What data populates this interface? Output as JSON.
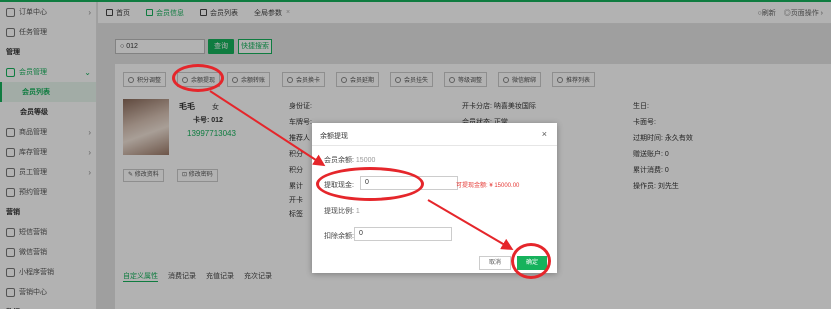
{
  "sidebar": {
    "items": [
      {
        "label": "订单中心",
        "type": "group"
      },
      {
        "label": "任务管理",
        "type": "plain"
      },
      {
        "label": "管理",
        "type": "section"
      },
      {
        "label": "会员管理",
        "type": "open"
      },
      {
        "label": "会员列表",
        "type": "active"
      },
      {
        "label": "会员等级",
        "type": "sub"
      },
      {
        "label": "商品管理",
        "type": "group"
      },
      {
        "label": "库存管理",
        "type": "group"
      },
      {
        "label": "员工管理",
        "type": "group"
      },
      {
        "label": "预约管理",
        "type": "plain"
      },
      {
        "label": "营销",
        "type": "section"
      },
      {
        "label": "短信营销",
        "type": "plain"
      },
      {
        "label": "微信营销",
        "type": "plain"
      },
      {
        "label": "小程序营销",
        "type": "plain"
      },
      {
        "label": "营销中心",
        "type": "plain"
      },
      {
        "label": "数据",
        "type": "section"
      }
    ]
  },
  "tabs": {
    "home": "首页",
    "member_info": "会员信息",
    "member_list": "会员列表",
    "global_params": "全局参数",
    "refresh": "刷新",
    "page_ops": "页面操作"
  },
  "search": {
    "value": "012",
    "query_label": "查询",
    "quick_label": "快捷搜索"
  },
  "toolbar": {
    "points": "积分调整",
    "withdraw": "余额提现",
    "transfer": "余额转账",
    "change_card": "会员换卡",
    "extend": "会员延期",
    "freeze": "会员挂失",
    "level": "等级调整",
    "wechat_unbind": "微信解绑",
    "referral": "推荐列表"
  },
  "member": {
    "name": "毛毛",
    "gender": "女",
    "card_no": "卡号: 012",
    "phone": "13997713043",
    "edit_profile": "修改资料",
    "change_password": "修改密码",
    "id_card": "身份证:",
    "birthday": "生日:",
    "open_store": "开卡分店: 呐喜美妆国际",
    "card_face": "卡面号:",
    "status": "会员状态: 正常",
    "expire": "过期时间: 永久有效",
    "referrer": "推荐人",
    "gift_account": "赠送账户: 0",
    "points": "积分",
    "total_spent": "累计消费: 0",
    "cumulative": "累计",
    "operator": "操作员: 刘先生",
    "open_card": "开卡",
    "tags": "标签"
  },
  "subtabs": [
    "自定义属性",
    "消费记录",
    "充值记录",
    "充次记录"
  ],
  "modal": {
    "title": "余额提现",
    "close": "×",
    "balance_label": "会员余额:",
    "balance_value": "15000",
    "withdraw_label": "提取现金:",
    "withdraw_value": "0",
    "withdrawable": "可提现金额: ¥ 15000.00",
    "ratio_label": "提现比例:",
    "ratio_value": "1",
    "deduct_label": "扣除余额:",
    "deduct_value": "0",
    "cancel": "取消",
    "confirm": "确定"
  },
  "colors": {
    "accent": "#16b25c",
    "annotation": "#e5262b"
  }
}
